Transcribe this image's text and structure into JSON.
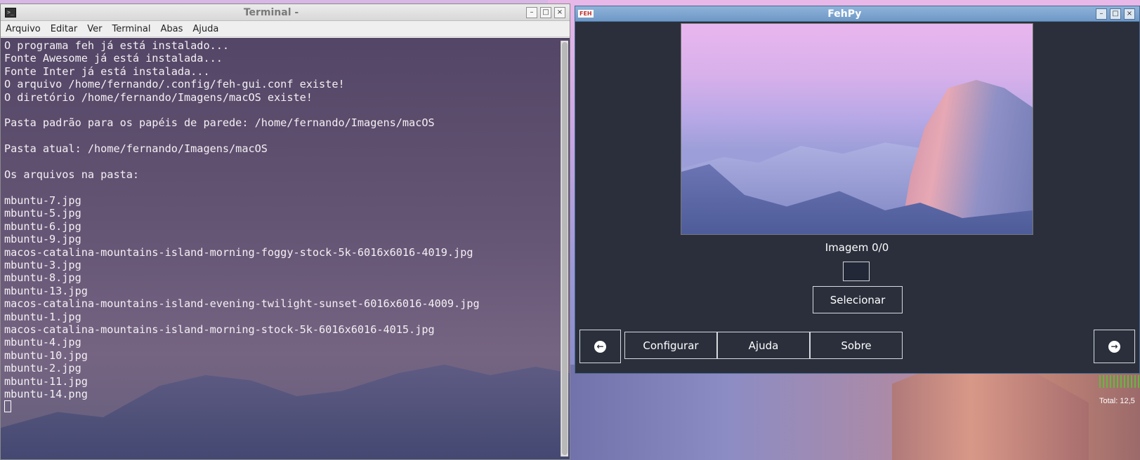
{
  "terminal": {
    "title": "Terminal -",
    "app_icon_glyph": ">_",
    "menu": [
      "Arquivo",
      "Editar",
      "Ver",
      "Terminal",
      "Abas",
      "Ajuda"
    ],
    "window_controls": {
      "minimize": "–",
      "maximize": "□",
      "close": "×"
    },
    "lines": [
      "O programa feh já está instalado...",
      "Fonte Awesome já está instalada...",
      "Fonte Inter já está instalada...",
      "O arquivo /home/fernando/.config/feh-gui.conf existe!",
      "O diretório /home/fernando/Imagens/macOS existe!",
      "",
      "Pasta padrão para os papéis de parede: /home/fernando/Imagens/macOS",
      "",
      "Pasta atual: /home/fernando/Imagens/macOS",
      "",
      "Os arquivos na pasta:",
      "",
      "mbuntu-7.jpg",
      "mbuntu-5.jpg",
      "mbuntu-6.jpg",
      "mbuntu-9.jpg",
      "macos-catalina-mountains-island-morning-foggy-stock-5k-6016x6016-4019.jpg",
      "mbuntu-3.jpg",
      "mbuntu-8.jpg",
      "mbuntu-13.jpg",
      "macos-catalina-mountains-island-evening-twilight-sunset-6016x6016-4009.jpg",
      "mbuntu-1.jpg",
      "macos-catalina-mountains-island-morning-stock-5k-6016x6016-4015.jpg",
      "mbuntu-4.jpg",
      "mbuntu-10.jpg",
      "mbuntu-2.jpg",
      "mbuntu-11.jpg",
      "mbuntu-14.png"
    ]
  },
  "fehpy": {
    "title": "FehPy",
    "icon_label": "FEH",
    "window_controls": {
      "minimize": "–",
      "maximize": "□",
      "close": "×"
    },
    "image_counter": "Imagem 0/0",
    "select_label": "Selecionar",
    "prev_icon": "arrow-left-circle-icon",
    "next_icon": "arrow-right-circle-icon",
    "prev_glyph": "←",
    "next_glyph": "→",
    "bottom_buttons": {
      "configure": "Configurar",
      "help": "Ajuda",
      "about": "Sobre"
    }
  },
  "desktop": {
    "monitor_text": "Total: 12,5"
  },
  "colors": {
    "feh_background": "#2a2f3b",
    "feh_titlebar": "#6f98c6",
    "terminal_text": "#f4f0f4"
  }
}
